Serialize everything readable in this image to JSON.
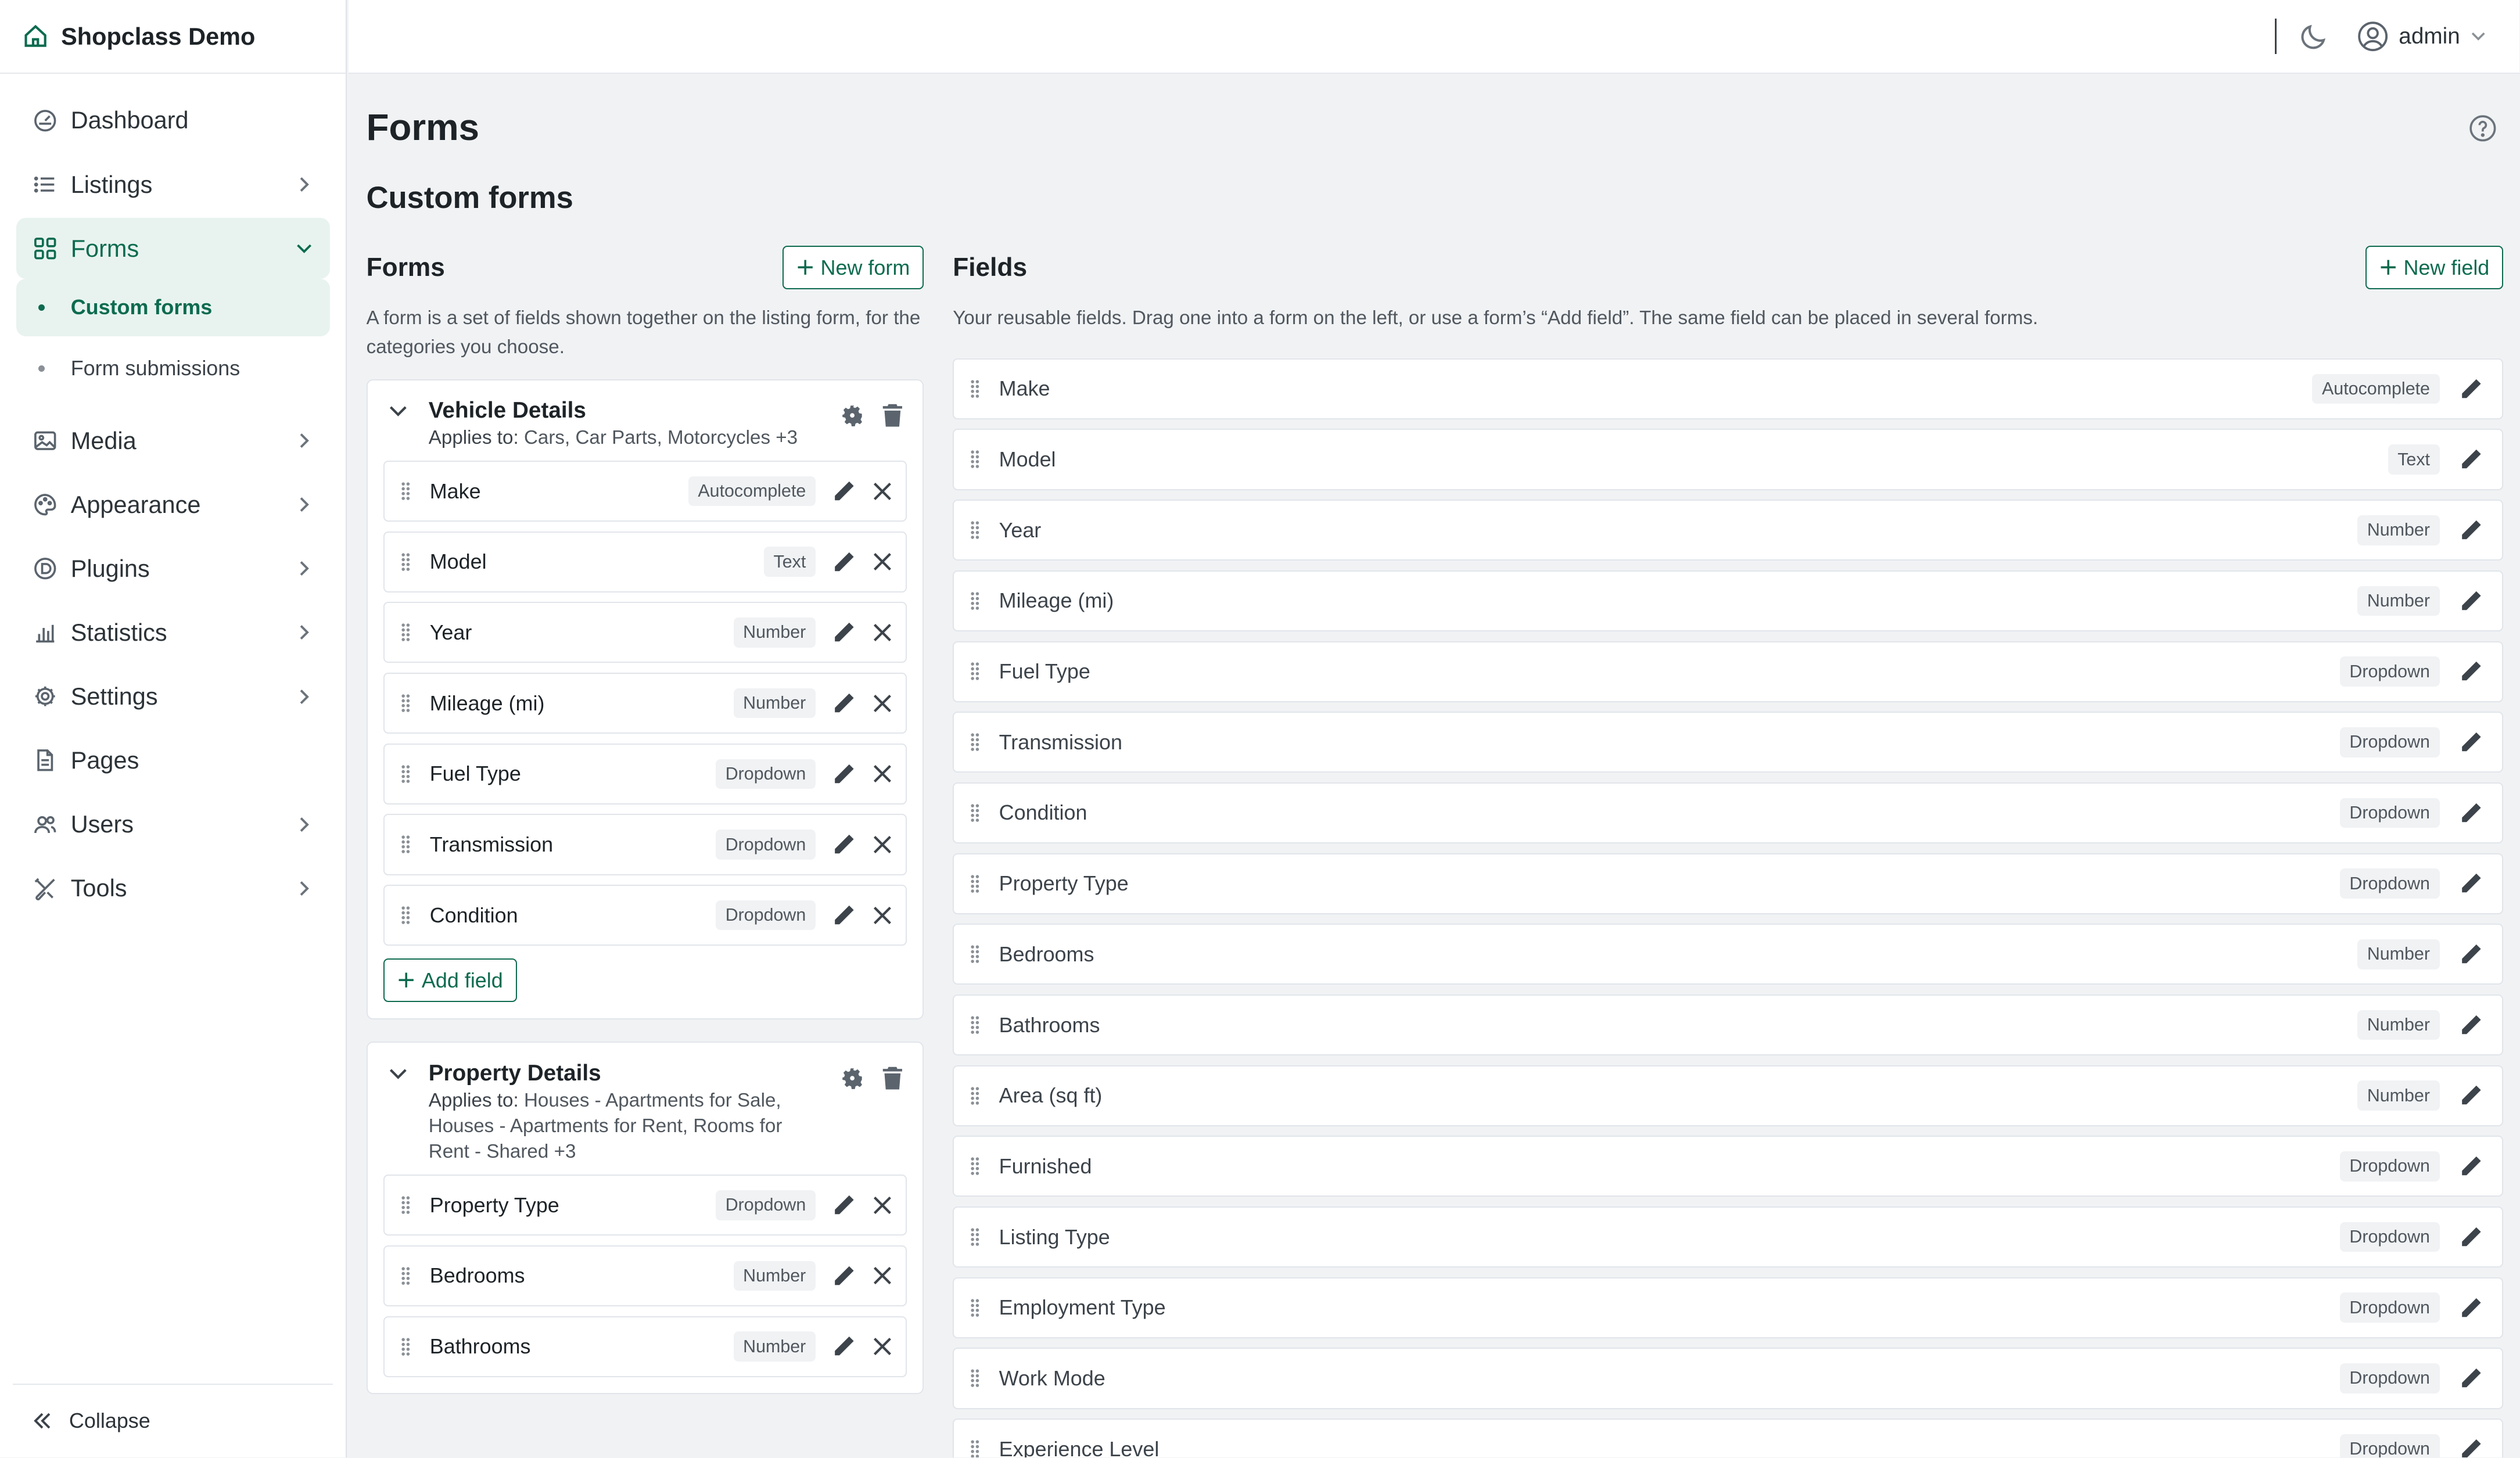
{
  "brand": {
    "title": "Shopclass Demo"
  },
  "sidebar": {
    "items": [
      {
        "label": "Dashboard",
        "icon": "dashboard-icon"
      },
      {
        "label": "Listings",
        "icon": "list-icon"
      },
      {
        "label": "Forms",
        "icon": "forms-icon"
      },
      {
        "label": "Media",
        "icon": "media-icon"
      },
      {
        "label": "Appearance",
        "icon": "palette-icon"
      },
      {
        "label": "Plugins",
        "icon": "plugin-icon"
      },
      {
        "label": "Statistics",
        "icon": "chart-icon"
      },
      {
        "label": "Settings",
        "icon": "gear-icon"
      },
      {
        "label": "Pages",
        "icon": "page-icon"
      },
      {
        "label": "Users",
        "icon": "users-icon"
      },
      {
        "label": "Tools",
        "icon": "tools-icon"
      }
    ],
    "forms_sub": [
      {
        "label": "Custom forms"
      },
      {
        "label": "Form submissions"
      }
    ],
    "collapse_label": "Collapse"
  },
  "topbar": {
    "user": "admin"
  },
  "page": {
    "title": "Forms",
    "section": "Custom forms"
  },
  "forms_col": {
    "title": "Forms",
    "new_label": "New form",
    "description": "A form is a set of fields shown together on the listing form, for the categories you choose.",
    "cards": [
      {
        "name": "Vehicle Details",
        "applies_label": "Applies to:",
        "applies": "Cars, Car Parts, Motorcycles +3",
        "fields": [
          {
            "name": "Make",
            "type": "Autocomplete"
          },
          {
            "name": "Model",
            "type": "Text"
          },
          {
            "name": "Year",
            "type": "Number"
          },
          {
            "name": "Mileage (mi)",
            "type": "Number"
          },
          {
            "name": "Fuel Type",
            "type": "Dropdown"
          },
          {
            "name": "Transmission",
            "type": "Dropdown"
          },
          {
            "name": "Condition",
            "type": "Dropdown"
          }
        ],
        "add_label": "Add field"
      },
      {
        "name": "Property Details",
        "applies_label": "Applies to:",
        "applies": "Houses - Apartments for Sale, Houses - Apartments for Rent, Rooms for Rent - Shared +3",
        "fields": [
          {
            "name": "Property Type",
            "type": "Dropdown"
          },
          {
            "name": "Bedrooms",
            "type": "Number"
          },
          {
            "name": "Bathrooms",
            "type": "Number"
          }
        ]
      }
    ]
  },
  "fields_col": {
    "title": "Fields",
    "new_label": "New field",
    "description": "Your reusable fields. Drag one into a form on the left, or use a form’s “Add field”. The same field can be placed in several forms.",
    "items": [
      {
        "name": "Make",
        "type": "Autocomplete"
      },
      {
        "name": "Model",
        "type": "Text"
      },
      {
        "name": "Year",
        "type": "Number"
      },
      {
        "name": "Mileage (mi)",
        "type": "Number"
      },
      {
        "name": "Fuel Type",
        "type": "Dropdown"
      },
      {
        "name": "Transmission",
        "type": "Dropdown"
      },
      {
        "name": "Condition",
        "type": "Dropdown"
      },
      {
        "name": "Property Type",
        "type": "Dropdown"
      },
      {
        "name": "Bedrooms",
        "type": "Number"
      },
      {
        "name": "Bathrooms",
        "type": "Number"
      },
      {
        "name": "Area (sq ft)",
        "type": "Number"
      },
      {
        "name": "Furnished",
        "type": "Dropdown"
      },
      {
        "name": "Listing Type",
        "type": "Dropdown"
      },
      {
        "name": "Employment Type",
        "type": "Dropdown"
      },
      {
        "name": "Work Mode",
        "type": "Dropdown"
      },
      {
        "name": "Experience Level",
        "type": "Dropdown"
      }
    ]
  },
  "colors": {
    "accent": "#0d6b4f",
    "accent_bg": "#e8f3ef",
    "page_bg": "#f0f2f4"
  }
}
